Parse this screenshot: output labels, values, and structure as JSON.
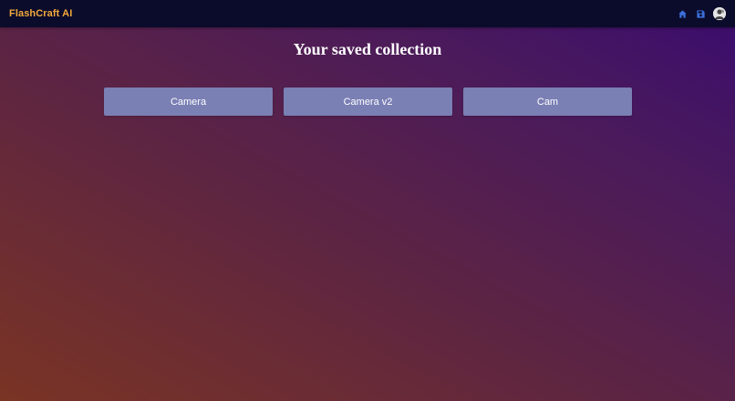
{
  "app": {
    "brand": "FlashCraft AI"
  },
  "nav": {
    "icons": [
      "home-icon",
      "save-icon",
      "avatar"
    ],
    "accent": "#3b6fd8"
  },
  "main": {
    "title": "Your saved collection",
    "collections": [
      {
        "label": "Camera"
      },
      {
        "label": "Camera v2"
      },
      {
        "label": "Cam"
      }
    ]
  },
  "colors": {
    "topbar": "#0b0b2b",
    "brand": "#f2a93b",
    "card": "#7a7fb4"
  }
}
